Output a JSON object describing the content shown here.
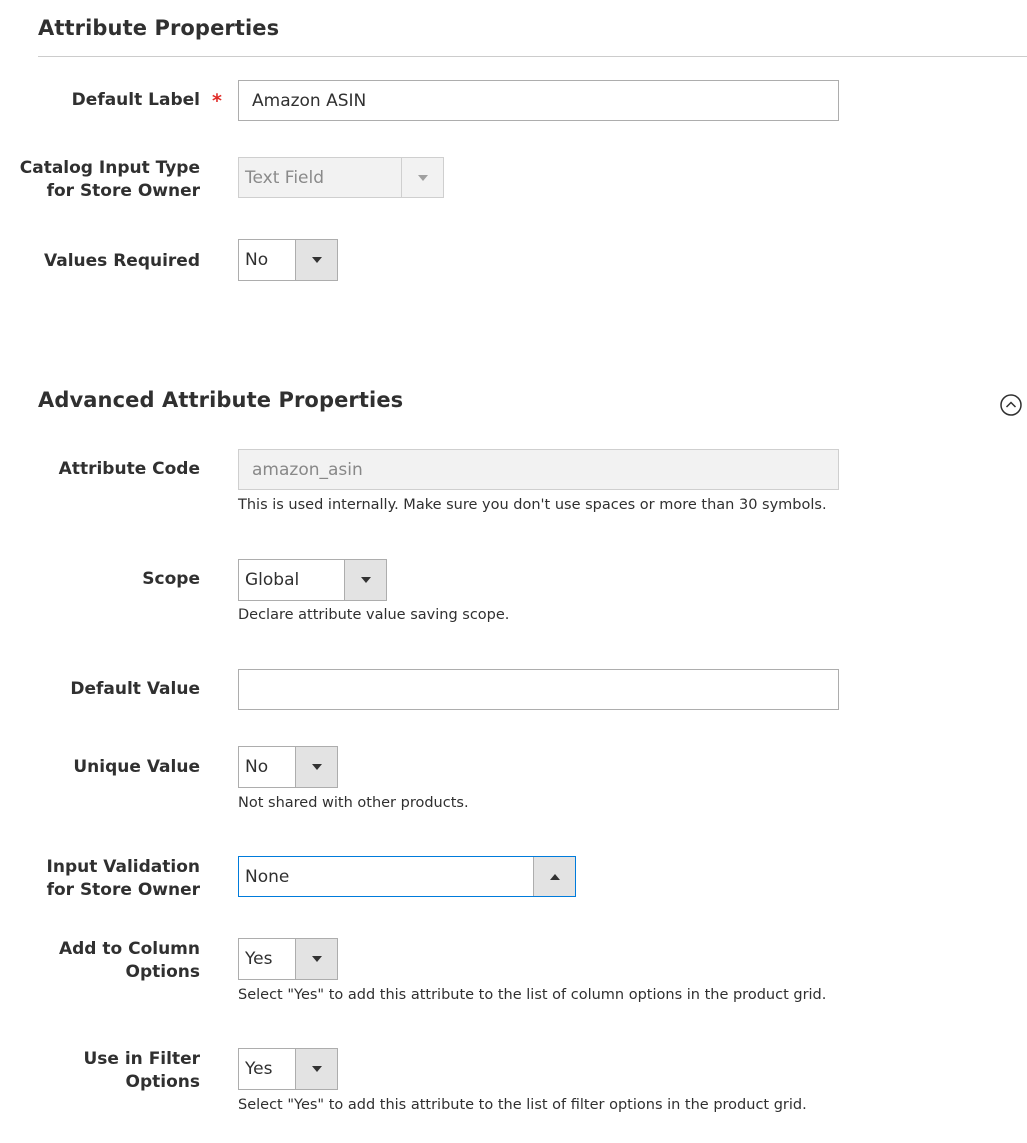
{
  "attribute_properties": {
    "title": "Attribute Properties",
    "default_label": {
      "label": "Default Label",
      "required_mark": "*",
      "value": "Amazon ASIN"
    },
    "catalog_input_type": {
      "label_line1": "Catalog Input Type",
      "label_line2": "for Store Owner",
      "value": "Text Field"
    },
    "values_required": {
      "label": "Values Required",
      "value": "No"
    }
  },
  "advanced": {
    "title": "Advanced Attribute Properties",
    "collapse_icon": "chevron-up-circle-icon",
    "attribute_code": {
      "label": "Attribute Code",
      "value": "amazon_asin",
      "note": "This is used internally. Make sure you don't use spaces or more than 30 symbols."
    },
    "scope": {
      "label": "Scope",
      "value": "Global",
      "note": "Declare attribute value saving scope."
    },
    "default_value": {
      "label": "Default Value",
      "value": ""
    },
    "unique_value": {
      "label": "Unique Value",
      "value": "No",
      "note": "Not shared with other products."
    },
    "input_validation": {
      "label_line1": "Input Validation",
      "label_line2": "for Store Owner",
      "value": "None"
    },
    "add_to_column": {
      "label_line1": "Add to Column",
      "label_line2": "Options",
      "value": "Yes",
      "note": "Select \"Yes\" to add this attribute to the list of column options in the product grid."
    },
    "use_in_filter": {
      "label_line1": "Use in Filter",
      "label_line2": "Options",
      "value": "Yes",
      "note": "Select \"Yes\" to add this attribute to the list of filter options in the product grid."
    }
  },
  "colors": {
    "required": "#e02b27",
    "focus": "#007bdb",
    "text": "#303030"
  }
}
